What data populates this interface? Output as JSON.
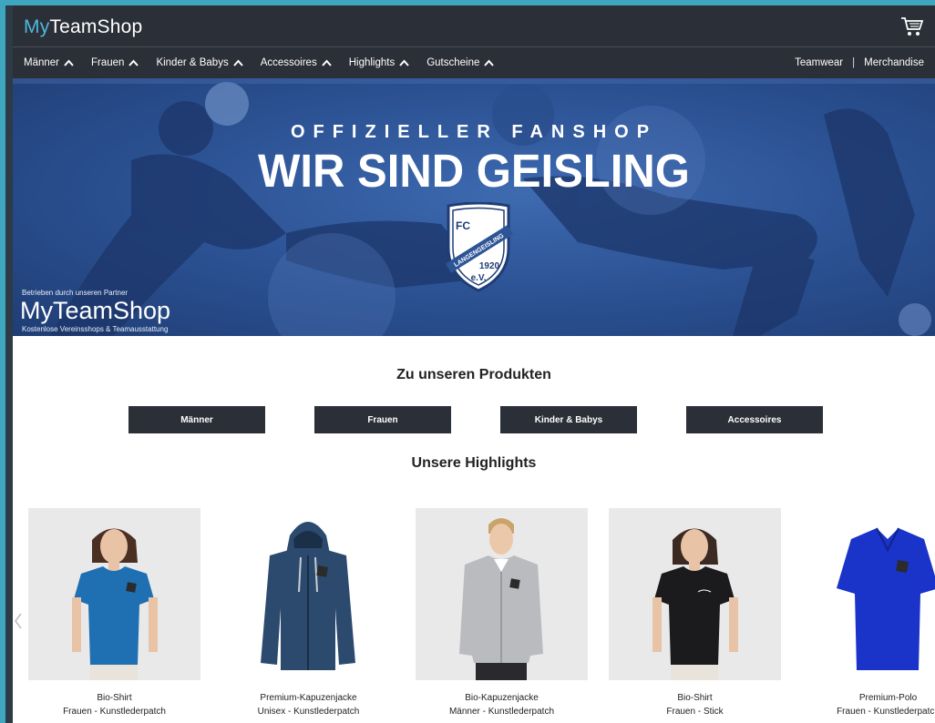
{
  "header": {
    "logo_my": "My",
    "logo_rest": "TeamShop",
    "cart_icon": "cart-icon"
  },
  "nav": {
    "items": [
      {
        "label": "Männer"
      },
      {
        "label": "Frauen"
      },
      {
        "label": "Kinder & Babys"
      },
      {
        "label": "Accessoires"
      },
      {
        "label": "Highlights"
      },
      {
        "label": "Gutscheine"
      }
    ],
    "right": {
      "teamwear": "Teamwear",
      "separator": "|",
      "merchandise": "Merchandise"
    }
  },
  "banner": {
    "subtitle": "OFFIZIELLER FANSHOP",
    "title": "WIR SIND GEISLING",
    "crest": {
      "fc": "FC",
      "name": "LANGENGEISLING",
      "year": "1920",
      "ev": "e.V."
    },
    "partner_small": "Betrieben durch unseren Partner",
    "partner_logo": "MyTeamShop",
    "partner_tagline": "Kostenlose Vereinsshops & Teamausstattung"
  },
  "products_section": {
    "title": "Zu unseren Produkten",
    "buttons": [
      {
        "label": "Männer"
      },
      {
        "label": "Frauen"
      },
      {
        "label": "Kinder & Babys"
      },
      {
        "label": "Accessoires"
      }
    ]
  },
  "highlights": {
    "title": "Unsere Highlights",
    "items": [
      {
        "name": "Bio-Shirt",
        "sub": "Frauen - Kunstlederpatch",
        "color": "#1f6fb3",
        "bg": "#e9e9ea"
      },
      {
        "name": "Premium-Kapuzenjacke",
        "sub": "Unisex - Kunstlederpatch",
        "color": "#2c4a6e",
        "bg": "#ffffff"
      },
      {
        "name": "Bio-Kapuzenjacke",
        "sub": "Männer - Kunstlederpatch",
        "color": "#b9bbbe",
        "bg": "#e9e9ea"
      },
      {
        "name": "Bio-Shirt",
        "sub": "Frauen - Stick",
        "color": "#1b1b1d",
        "bg": "#e9e9ea"
      },
      {
        "name": "Premium-Polo",
        "sub": "Frauen - Kunstlederpatch",
        "color": "#1a33c8",
        "bg": "#ffffff"
      }
    ]
  },
  "colors": {
    "accent": "#4fb8e0",
    "dark": "#2b2f37",
    "banner_blue": "#2d5496"
  }
}
